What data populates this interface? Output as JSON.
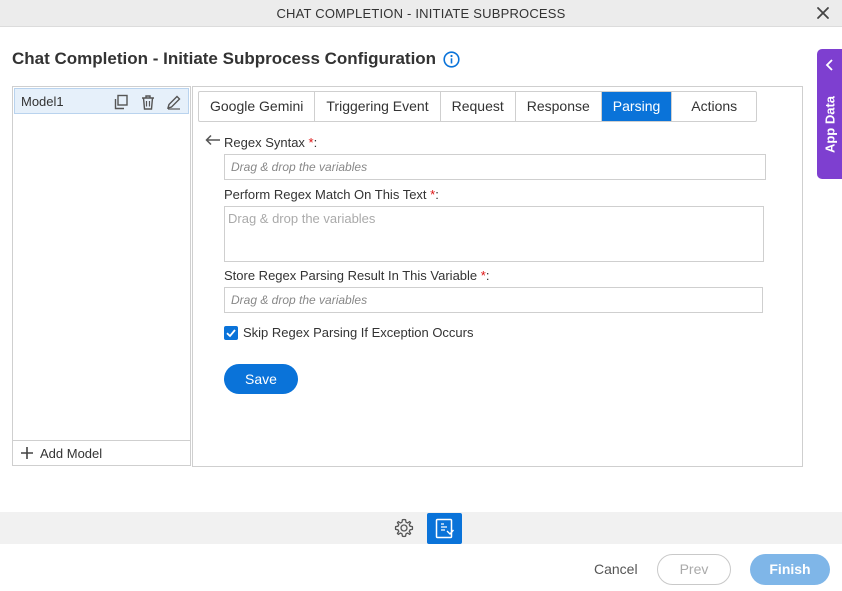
{
  "window": {
    "title": "CHAT COMPLETION - INITIATE SUBPROCESS"
  },
  "page": {
    "heading": "Chat Completion - Initiate Subprocess Configuration"
  },
  "app_data": {
    "label": "App Data"
  },
  "models": {
    "items": [
      {
        "name": "Model1"
      }
    ],
    "add_label": "Add Model"
  },
  "tabs": [
    {
      "label": "Google Gemini",
      "active": false
    },
    {
      "label": "Triggering Event",
      "active": false
    },
    {
      "label": "Request",
      "active": false
    },
    {
      "label": "Response",
      "active": false
    },
    {
      "label": "Parsing",
      "active": true
    },
    {
      "label": "Actions",
      "active": false
    }
  ],
  "form": {
    "regex_syntax": {
      "label": "Regex Syntax ",
      "required": "*",
      "colon": ":",
      "placeholder": "Drag & drop the variables"
    },
    "match_text": {
      "label": "Perform Regex Match On This Text ",
      "required": "*",
      "colon": ":",
      "placeholder": "Drag & drop the variables"
    },
    "store_result": {
      "label": "Store Regex Parsing Result In This Variable ",
      "required": "*",
      "colon": ":",
      "placeholder": "Drag & drop the variables"
    },
    "skip_exception": {
      "label": "Skip Regex Parsing If Exception Occurs",
      "checked": true
    },
    "save_label": "Save"
  },
  "footer": {
    "cancel_label": "Cancel",
    "prev_label": "Prev",
    "finish_label": "Finish"
  },
  "colors": {
    "accent": "#0a73d9",
    "app_data": "#7e3fd0",
    "finish_disabled": "#7fb6e8"
  }
}
